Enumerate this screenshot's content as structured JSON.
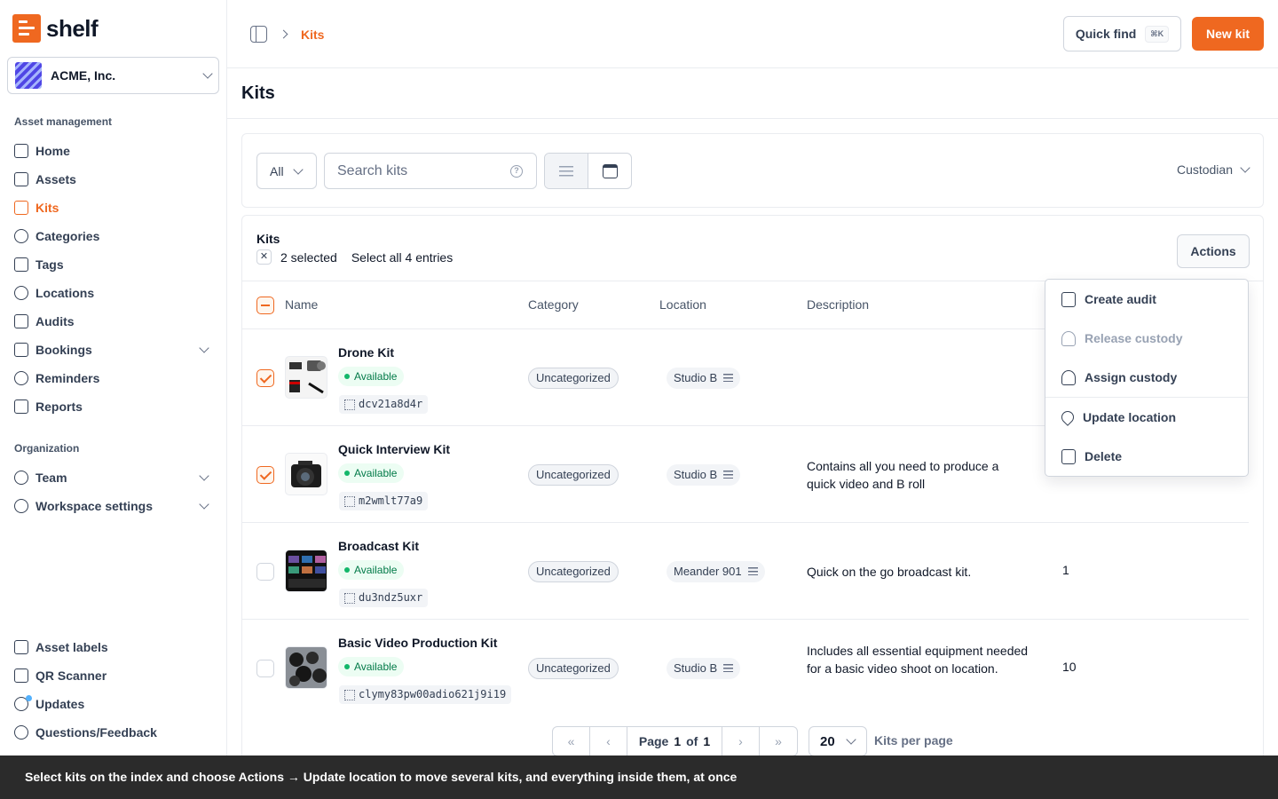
{
  "brand": {
    "name": "shelf",
    "color": "#ef6820"
  },
  "workspace": {
    "name": "ACME, Inc."
  },
  "sidebar": {
    "section_asset": "Asset management",
    "asset_items": [
      {
        "label": "Home",
        "icon": "home-icon"
      },
      {
        "label": "Assets",
        "icon": "cube-icon"
      },
      {
        "label": "Kits",
        "icon": "package-icon",
        "active": true
      },
      {
        "label": "Categories",
        "icon": "shapes-icon"
      },
      {
        "label": "Tags",
        "icon": "tag-icon"
      },
      {
        "label": "Locations",
        "icon": "map-pin-icon"
      },
      {
        "label": "Audits",
        "icon": "clipboard-icon"
      },
      {
        "label": "Bookings",
        "icon": "calendar-icon",
        "expandable": true
      },
      {
        "label": "Reminders",
        "icon": "alarm-icon"
      },
      {
        "label": "Reports",
        "icon": "report-icon"
      }
    ],
    "section_org": "Organization",
    "org_items": [
      {
        "label": "Team",
        "icon": "user-icon",
        "expandable": true
      },
      {
        "label": "Workspace settings",
        "icon": "gear-icon",
        "expandable": true
      }
    ],
    "footer_items": [
      {
        "label": "Asset labels",
        "icon": "qr-icon"
      },
      {
        "label": "QR Scanner",
        "icon": "scan-icon"
      },
      {
        "label": "Updates",
        "icon": "bell-icon"
      },
      {
        "label": "Questions/Feedback",
        "icon": "chat-icon"
      }
    ]
  },
  "topbar": {
    "breadcrumb": "Kits",
    "quick_find": "Quick find",
    "quick_find_shortcut": "⌘K",
    "new_kit": "New kit"
  },
  "page_title": "Kits",
  "filters": {
    "status_filter": "All",
    "search_placeholder": "Search kits",
    "custodian": "Custodian"
  },
  "table": {
    "title": "Kits",
    "selected_text": "2 selected",
    "select_all_text": "Select all 4 entries",
    "actions_label": "Actions",
    "columns": [
      "Name",
      "Category",
      "Location",
      "Description"
    ],
    "rows": [
      {
        "name": "Drone Kit",
        "status": "Available",
        "code": "dcv21a8d4r",
        "category": "Uncategorized",
        "location": "Studio B",
        "description": "",
        "quantity": "",
        "checked": true
      },
      {
        "name": "Quick Interview Kit",
        "status": "Available",
        "code": "m2wmlt77a9",
        "category": "Uncategorized",
        "location": "Studio B",
        "description": "Contains all you need to produce a quick video and B roll",
        "quantity": "",
        "checked": true
      },
      {
        "name": "Broadcast Kit",
        "status": "Available",
        "code": "du3ndz5uxr",
        "category": "Uncategorized",
        "location": "Meander 901",
        "description": "Quick on the go broadcast kit.",
        "quantity": "1",
        "checked": false
      },
      {
        "name": "Basic Video Production Kit",
        "status": "Available",
        "code": "clymy83pw00adio621j9i19",
        "category": "Uncategorized",
        "location": "Studio B",
        "description": "Includes all essential equipment needed for a basic video shoot on location.",
        "quantity": "10",
        "checked": false
      }
    ]
  },
  "actions_menu": {
    "items": [
      {
        "label": "Create audit",
        "icon": "clipboard-icon",
        "disabled": false
      },
      {
        "label": "Release custody",
        "icon": "user-minus-icon",
        "disabled": true
      },
      {
        "label": "Assign custody",
        "icon": "user-plus-icon",
        "disabled": false
      },
      {
        "label": "Update location",
        "icon": "map-pin-icon",
        "disabled": false
      },
      {
        "label": "Delete",
        "icon": "trash-icon",
        "disabled": false
      }
    ]
  },
  "pagination": {
    "page_label": "Page",
    "current": "1",
    "of_label": "of",
    "total": "1",
    "per_page": "20",
    "per_page_label": "Kits per page"
  },
  "banner": "Select kits on the index and choose Actions → Update location to move several kits, and everything inside them, at once"
}
